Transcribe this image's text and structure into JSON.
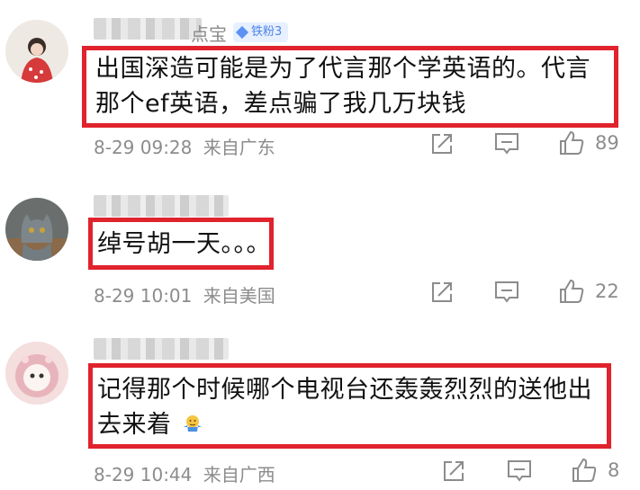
{
  "comments": [
    {
      "name_tail": "点宝",
      "badge": "铁粉3",
      "text_lines": [
        "出国深造可能是为了代言那个学英语的。代言",
        "那个ef英语，差点骗了我几万块钱"
      ],
      "date": "8-29 09:28",
      "location": "来自广东",
      "likes": "89"
    },
    {
      "text_lines": [
        "绰号胡一天。。。"
      ],
      "date": "8-29 10:01",
      "location": "来自美国",
      "likes": "22"
    },
    {
      "text_lines": [
        "记得那个时候哪个电视台还轰轰烈烈的送他出",
        "去来着"
      ],
      "emoji": "shrug-emoji",
      "date": "8-29 10:44",
      "location": "来自广西",
      "likes": "8"
    }
  ],
  "colors": {
    "highlight": "#e0232c",
    "badge_bg": "#e7f0ff",
    "badge_text": "#4d83e8",
    "meta": "#8c8c8c"
  },
  "icons": [
    "share-icon",
    "comment-icon",
    "like-icon"
  ]
}
